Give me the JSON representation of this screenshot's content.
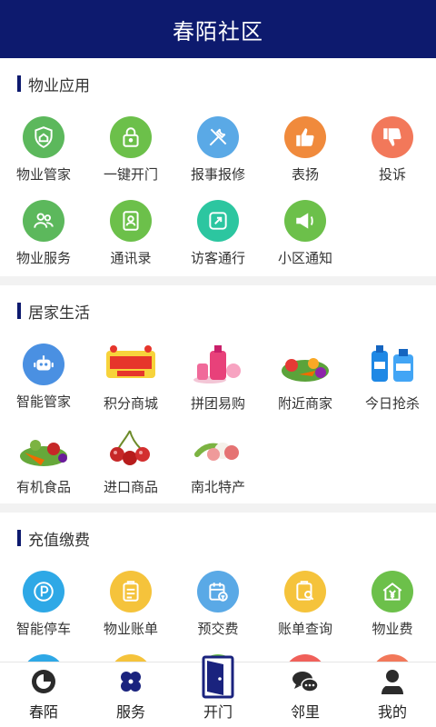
{
  "app": {
    "title": "春陌社区"
  },
  "sections": [
    {
      "title": "物业应用",
      "items": [
        {
          "label": "物业管家",
          "icon": "shield-house-icon",
          "color": "#5cb85c"
        },
        {
          "label": "一键开门",
          "icon": "lock-icon",
          "color": "#6cc04a"
        },
        {
          "label": "报事报修",
          "icon": "tools-icon",
          "color": "#5aa9e6"
        },
        {
          "label": "表扬",
          "icon": "thumbs-up-icon",
          "color": "#f08a3c"
        },
        {
          "label": "投诉",
          "icon": "thumbs-down-icon",
          "color": "#f2785a"
        },
        {
          "label": "物业服务",
          "icon": "people-icon",
          "color": "#5cb85c"
        },
        {
          "label": "通讯录",
          "icon": "contacts-icon",
          "color": "#6cc04a"
        },
        {
          "label": "访客通行",
          "icon": "pass-icon",
          "color": "#2cc6a0"
        },
        {
          "label": "小区通知",
          "icon": "megaphone-icon",
          "color": "#6cc04a"
        }
      ]
    },
    {
      "title": "居家生活",
      "items": [
        {
          "label": "智能管家",
          "icon": "robot-icon",
          "color": "#4a90e2"
        },
        {
          "label": "积分商城",
          "icon": "points-mall-image"
        },
        {
          "label": "拼团易购",
          "icon": "group-buy-image"
        },
        {
          "label": "附近商家",
          "icon": "vegetables-image"
        },
        {
          "label": "今日抢杀",
          "icon": "detergent-image"
        },
        {
          "label": "有机食品",
          "icon": "organic-food-image"
        },
        {
          "label": "进口商品",
          "icon": "cherries-image"
        },
        {
          "label": "南北特产",
          "icon": "lychee-image"
        }
      ]
    },
    {
      "title": "充值缴费",
      "items": [
        {
          "label": "智能停车",
          "icon": "parking-icon",
          "color": "#2ea8e6"
        },
        {
          "label": "物业账单",
          "icon": "bill-icon",
          "color": "#f5c33b"
        },
        {
          "label": "预交费",
          "icon": "calendar-pay-icon",
          "color": "#5aa9e6"
        },
        {
          "label": "账单查询",
          "icon": "bill-search-icon",
          "color": "#f5c33b"
        },
        {
          "label": "物业费",
          "icon": "house-yen-icon",
          "color": "#6cc04a"
        },
        {
          "label": "",
          "icon": "parking-icon",
          "color": "#2ea8e6"
        },
        {
          "label": "",
          "icon": "water-drop-icon",
          "color": "#f5c33b"
        },
        {
          "label": "",
          "icon": "lightning-icon",
          "color": "#6cc04a"
        },
        {
          "label": "",
          "icon": "flame-icon",
          "color": "#f0605a"
        },
        {
          "label": "",
          "icon": "heating-icon",
          "color": "#f2785a"
        }
      ]
    }
  ],
  "tabs": [
    {
      "label": "春陌",
      "icon": "home-logo-icon"
    },
    {
      "label": "服务",
      "icon": "services-grid-icon"
    },
    {
      "label": "开门",
      "icon": "door-icon"
    },
    {
      "label": "邻里",
      "icon": "chat-bubbles-icon"
    },
    {
      "label": "我的",
      "icon": "person-icon"
    }
  ]
}
